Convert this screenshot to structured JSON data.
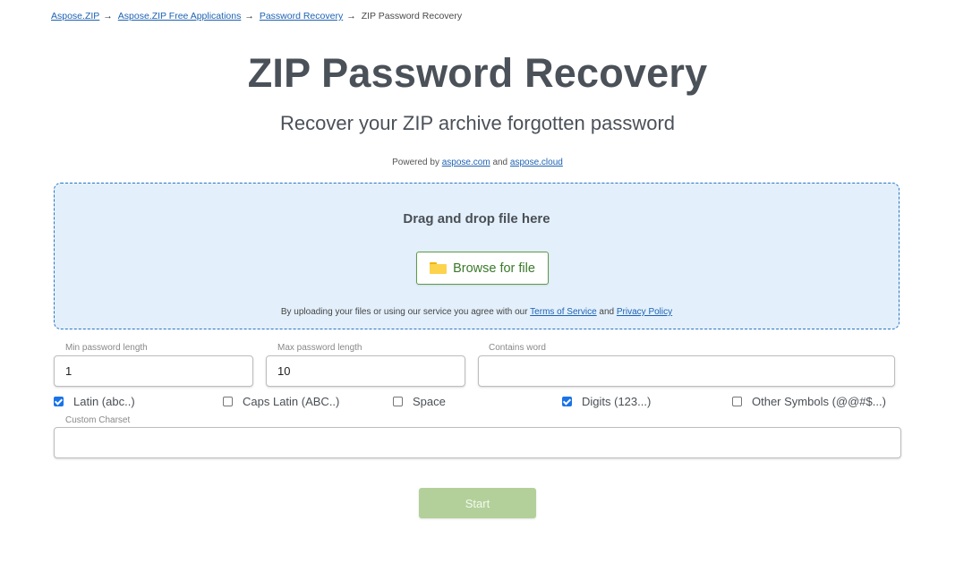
{
  "breadcrumb": {
    "items": [
      {
        "label": "Aspose.ZIP",
        "link": true
      },
      {
        "label": "Aspose.ZIP Free Applications",
        "link": true
      },
      {
        "label": "Password Recovery",
        "link": true
      },
      {
        "label": "ZIP Password Recovery",
        "link": false
      }
    ],
    "separator": "→"
  },
  "header": {
    "title": "ZIP Password Recovery",
    "subtitle": "Recover your ZIP archive forgotten password",
    "powered_prefix": "Powered by",
    "powered_link1": "aspose.com",
    "powered_and": "and",
    "powered_link2": "aspose.cloud"
  },
  "dropzone": {
    "title": "Drag and drop file here",
    "browse_label": "Browse for file",
    "browse_icon": "folder-icon",
    "agree_prefix": "By uploading your files or using our service you agree with our",
    "terms_label": "Terms of Service",
    "agree_and": "and",
    "privacy_label": "Privacy Policy"
  },
  "form": {
    "min_length": {
      "label": "Min password length",
      "value": "1"
    },
    "max_length": {
      "label": "Max password length",
      "value": "10"
    },
    "contains_word": {
      "label": "Contains word",
      "value": ""
    },
    "charsets": [
      {
        "label": "Latin (abc..)",
        "checked": true
      },
      {
        "label": "Caps Latin (ABC..)",
        "checked": false
      },
      {
        "label": "Space",
        "checked": false
      },
      {
        "label": "Digits (123...)",
        "checked": true
      },
      {
        "label": "Other Symbols (@@#$...)",
        "checked": false
      }
    ],
    "custom_charset": {
      "label": "Custom Charset",
      "value": ""
    },
    "start_label": "Start"
  },
  "colors": {
    "accent_blue": "#1a73e8",
    "link": "#1d62b3",
    "dropzone_bg": "#e3f0fc",
    "browse_green": "#3a7a2a",
    "start_disabled": "#b3d09a"
  }
}
